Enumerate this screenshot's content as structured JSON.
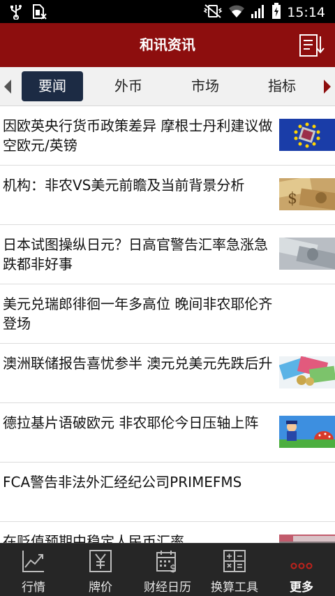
{
  "status_bar": {
    "time": "15:14",
    "icons": [
      "usb-icon",
      "no-sim-icon",
      "vibrate-mute-icon",
      "wifi-icon",
      "signal-icon",
      "battery-charging-icon"
    ]
  },
  "app_bar": {
    "title": "和讯资讯",
    "brand_color": "#8d0e0e",
    "action_icon": "sort-list-icon"
  },
  "tabs": {
    "items": [
      {
        "label": "要闻",
        "active": true
      },
      {
        "label": "外币",
        "active": false
      },
      {
        "label": "市场",
        "active": false
      },
      {
        "label": "指标",
        "active": false
      }
    ],
    "prev_icon": "arrow-left-icon",
    "next_icon": "arrow-right-icon",
    "active_color": "#1c2b44"
  },
  "news": [
    {
      "title": "因欧英央行货币政策差异 摩根士丹利建议做空欧元/英镑",
      "thumb": "euro-flag-thumbnail"
    },
    {
      "title": "机构：非农VS美元前瞻及当前背景分析",
      "thumb": "dollar-bills-thumbnail"
    },
    {
      "title": "日本试图操纵日元？日高官警告汇率急涨急跌都非好事",
      "thumb": "yen-notes-thumbnail"
    },
    {
      "title": "美元兑瑞郎徘徊一年多高位 晚间非农耶伦齐登场",
      "thumb": ""
    },
    {
      "title": "澳洲联储报告喜忧参半 澳元兑美元先跌后升",
      "thumb": "aud-notes-thumbnail"
    },
    {
      "title": "德拉基片语破欧元 非农耶伦今日压轴上阵",
      "thumb": "cartoon-thumbnail"
    },
    {
      "title": "FCA警告非法外汇经纪公司PRIMEFMS",
      "thumb": ""
    },
    {
      "title": "在贬值预期中稳定人民币汇率",
      "thumb": "rmb-notes-thumbnail"
    }
  ],
  "bottom_nav": [
    {
      "label": "行情",
      "icon": "line-chart-icon",
      "active": false
    },
    {
      "label": "牌价",
      "icon": "yuan-board-icon",
      "active": false
    },
    {
      "label": "财经日历",
      "icon": "calendar-dollar-icon",
      "active": false
    },
    {
      "label": "换算工具",
      "icon": "calculator-icon",
      "active": false
    },
    {
      "label": "更多",
      "icon": "more-dots-icon",
      "active": true
    }
  ]
}
